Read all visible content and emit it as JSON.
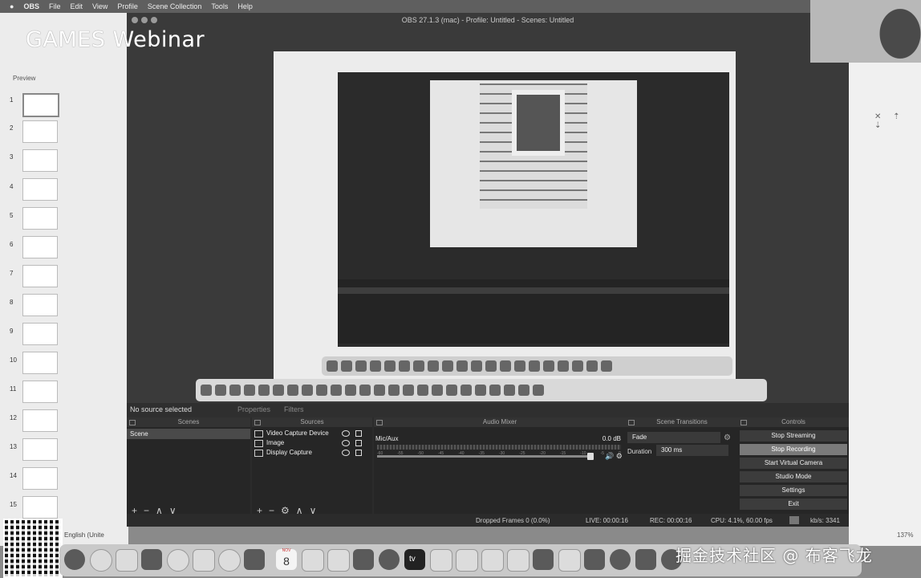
{
  "menubar": {
    "app_name": "OBS",
    "items": [
      "File",
      "Edit",
      "View",
      "Profile",
      "Scene Collection",
      "Tools",
      "Help"
    ]
  },
  "keynote": {
    "overlay_title": "GAMES Webinar",
    "preview_label": "Preview",
    "slide_numbers": [
      "1",
      "2",
      "3",
      "4",
      "5",
      "6",
      "7",
      "8",
      "9",
      "10",
      "11",
      "12",
      "13",
      "14",
      "15"
    ],
    "language_label": "English (Unite"
  },
  "obs": {
    "window_title": "OBS 27.1.3 (mac) - Profile: Untitled - Scenes: Untitled",
    "no_source": "No source selected",
    "properties_tab": "Properties",
    "filters_tab": "Filters",
    "docks": {
      "scenes": "Scenes",
      "sources": "Sources",
      "mixer": "Audio Mixer",
      "transitions": "Scene Transitions",
      "controls": "Controls"
    },
    "scenes": [
      "Scene"
    ],
    "sources": [
      {
        "label": "Video Capture Device",
        "icon": "camera-icon"
      },
      {
        "label": "Image",
        "icon": "image-icon"
      },
      {
        "label": "Display Capture",
        "icon": "monitor-icon"
      }
    ],
    "mixer": {
      "track": "Mic/Aux",
      "db": "0.0 dB",
      "scale": [
        "-60",
        "-55",
        "-50",
        "-45",
        "-40",
        "-35",
        "-30",
        "-25",
        "-20",
        "-15",
        "-10",
        "-5",
        "0"
      ]
    },
    "transition": {
      "selected": "Fade",
      "duration_label": "Duration",
      "duration_value": "300 ms"
    },
    "controls": [
      "Stop Streaming",
      "Stop Recording",
      "Start Virtual Camera",
      "Studio Mode",
      "Settings",
      "Exit"
    ],
    "active_control_index": 1,
    "status": {
      "dropped": "Dropped Frames 0 (0.0%)",
      "live": "LIVE: 00:00:16",
      "rec": "REC: 00:00:16",
      "cpu": "CPU: 4.1%, 60.00 fps",
      "kbps": "kb/s: 3341"
    },
    "footer_glyphs": {
      "add": "+",
      "remove": "−",
      "up": "∧",
      "down": "∨",
      "gear": "⚙"
    }
  },
  "dock": {
    "calendar_month": "NOV",
    "calendar_day": "8",
    "tv_label": "tv"
  },
  "right": {
    "zoom": "137%",
    "controls_glyphs": "✕ ⇡ ⇣"
  },
  "watermark": "掘金技术社区 @ 布客飞龙"
}
